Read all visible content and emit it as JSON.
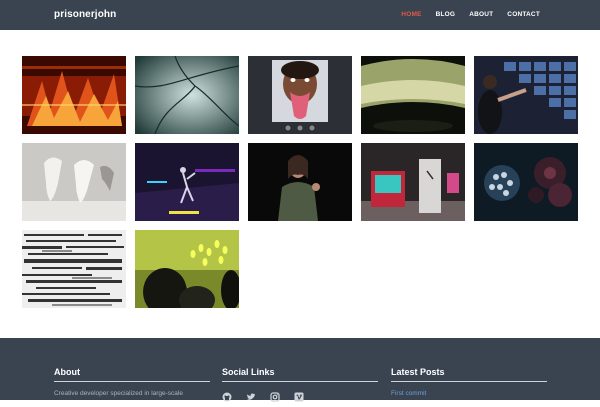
{
  "header": {
    "brand": "prisonerjohn",
    "nav": [
      {
        "label": "HOME",
        "active": true
      },
      {
        "label": "BLOG",
        "active": false
      },
      {
        "label": "ABOUT",
        "active": false
      },
      {
        "label": "CONTACT",
        "active": false
      }
    ]
  },
  "gallery": {
    "items": [
      {
        "icon": "thumb-fire-abstract"
      },
      {
        "icon": "thumb-teal-branches"
      },
      {
        "icon": "thumb-face-tongue"
      },
      {
        "icon": "thumb-panoramic-room"
      },
      {
        "icon": "thumb-touch-wall"
      },
      {
        "icon": "thumb-white-sculptures"
      },
      {
        "icon": "thumb-dancer-stage"
      },
      {
        "icon": "thumb-speaker-woman"
      },
      {
        "icon": "thumb-installation-booth"
      },
      {
        "icon": "thumb-cells-screen"
      },
      {
        "icon": "thumb-glitch-text"
      },
      {
        "icon": "thumb-crowd-lights"
      }
    ]
  },
  "footer": {
    "about": {
      "title": "About",
      "text": "Creative developer specialized in large-scale"
    },
    "social": {
      "title": "Social Links",
      "icons": [
        "github-icon",
        "twitter-icon",
        "instagram-icon",
        "vimeo-icon"
      ]
    },
    "latest": {
      "title": "Latest Posts",
      "posts": [
        "First commit"
      ]
    }
  },
  "colors": {
    "header_bg": "#3a4350",
    "accent": "#e05a4b",
    "link": "#6fa0d8"
  }
}
